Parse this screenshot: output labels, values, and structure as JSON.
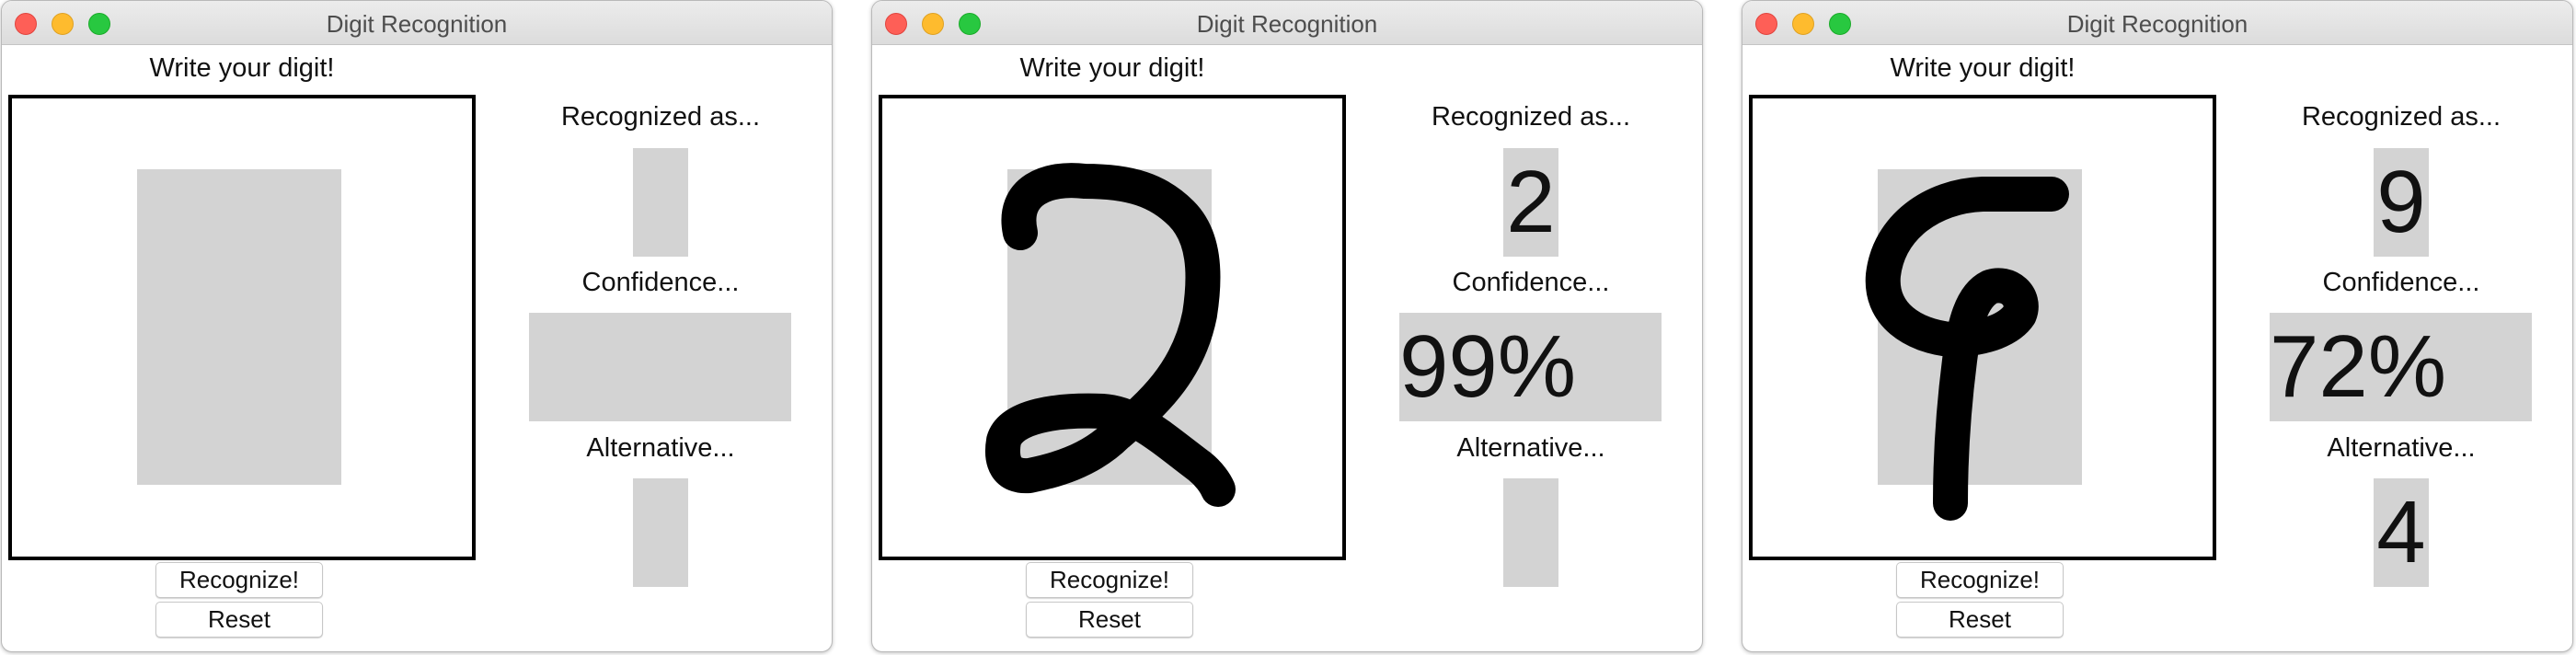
{
  "windows": [
    {
      "title": "Digit Recognition",
      "draw_label": "Write your digit!",
      "recognized_label": "Recognized as...",
      "recognized_value": "",
      "confidence_label": "Confidence...",
      "confidence_value": "",
      "alternative_label": "Alternative...",
      "alternative_value": "",
      "recognize_button": "Recognize!",
      "reset_button": "Reset",
      "drawn_digit": "none"
    },
    {
      "title": "Digit Recognition",
      "draw_label": "Write your digit!",
      "recognized_label": "Recognized as...",
      "recognized_value": "2",
      "confidence_label": "Confidence...",
      "confidence_value": "99%",
      "alternative_label": "Alternative...",
      "alternative_value": "",
      "recognize_button": "Recognize!",
      "reset_button": "Reset",
      "drawn_digit": "2"
    },
    {
      "title": "Digit Recognition",
      "draw_label": "Write your digit!",
      "recognized_label": "Recognized as...",
      "recognized_value": "9",
      "confidence_label": "Confidence...",
      "confidence_value": "72%",
      "alternative_label": "Alternative...",
      "alternative_value": "4",
      "recognize_button": "Recognize!",
      "reset_button": "Reset",
      "drawn_digit": "9"
    }
  ],
  "colors": {
    "canvas_border": "#000000",
    "result_box_bg": "#d3d3d3",
    "stroke": "#000000",
    "close": "#fe5f57",
    "minimize": "#febb2e",
    "maximize": "#28c840"
  },
  "icons": [
    "close-icon",
    "minimize-icon",
    "maximize-icon"
  ]
}
